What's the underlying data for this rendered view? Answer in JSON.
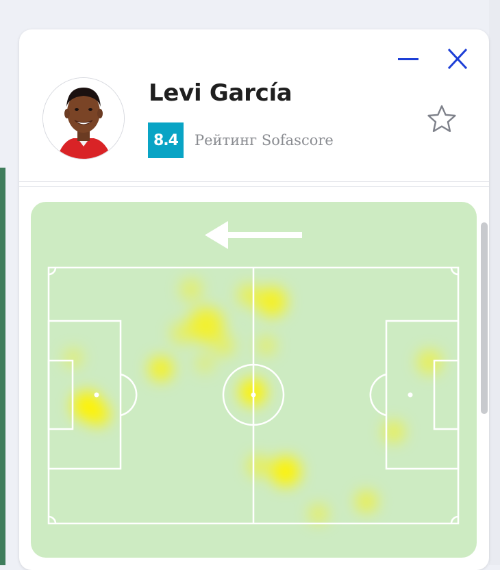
{
  "player": {
    "name": "Levi García",
    "rating": "8.4",
    "rating_label": "Рейтинг Sofascore"
  },
  "colors": {
    "rating_badge": "#09a4c5",
    "icons": "#1c3ed6",
    "pitch": "#cdebc2",
    "heat": "#ffee00"
  },
  "icons": {
    "minimize": "minus-icon",
    "close": "close-icon",
    "favorite": "star-outline-icon",
    "direction": "arrow-left-icon"
  },
  "heatmap": {
    "attack_direction": "left"
  }
}
